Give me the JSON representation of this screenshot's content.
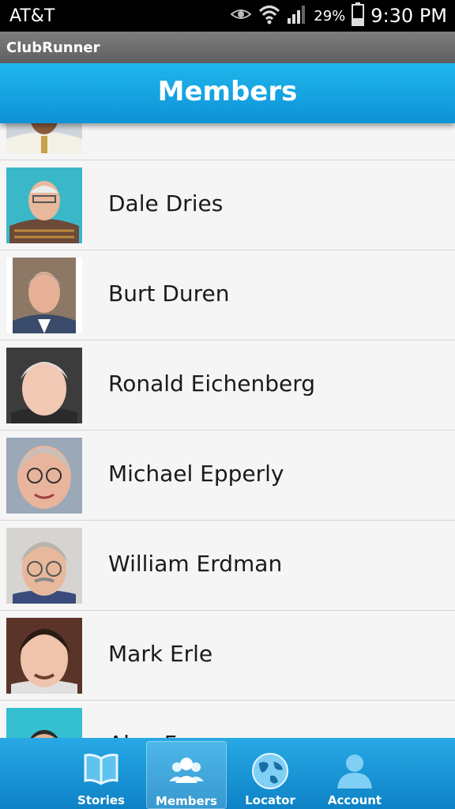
{
  "status_bar": {
    "carrier": "AT&T",
    "battery_percent": "29%",
    "time": "9:30 PM"
  },
  "app": {
    "name": "ClubRunner"
  },
  "header": {
    "title": "Members"
  },
  "members": [
    {
      "name": ""
    },
    {
      "name": "Dale Dries"
    },
    {
      "name": "Burt Duren"
    },
    {
      "name": "Ronald Eichenberg"
    },
    {
      "name": "Michael Epperly"
    },
    {
      "name": "William Erdman"
    },
    {
      "name": "Mark Erle"
    },
    {
      "name": "Alan Fer..."
    }
  ],
  "tabs": [
    {
      "label": "Stories",
      "icon": "book-icon"
    },
    {
      "label": "Members",
      "icon": "people-icon",
      "active": true
    },
    {
      "label": "Locator",
      "icon": "globe-icon"
    },
    {
      "label": "Account",
      "icon": "person-icon"
    }
  ]
}
